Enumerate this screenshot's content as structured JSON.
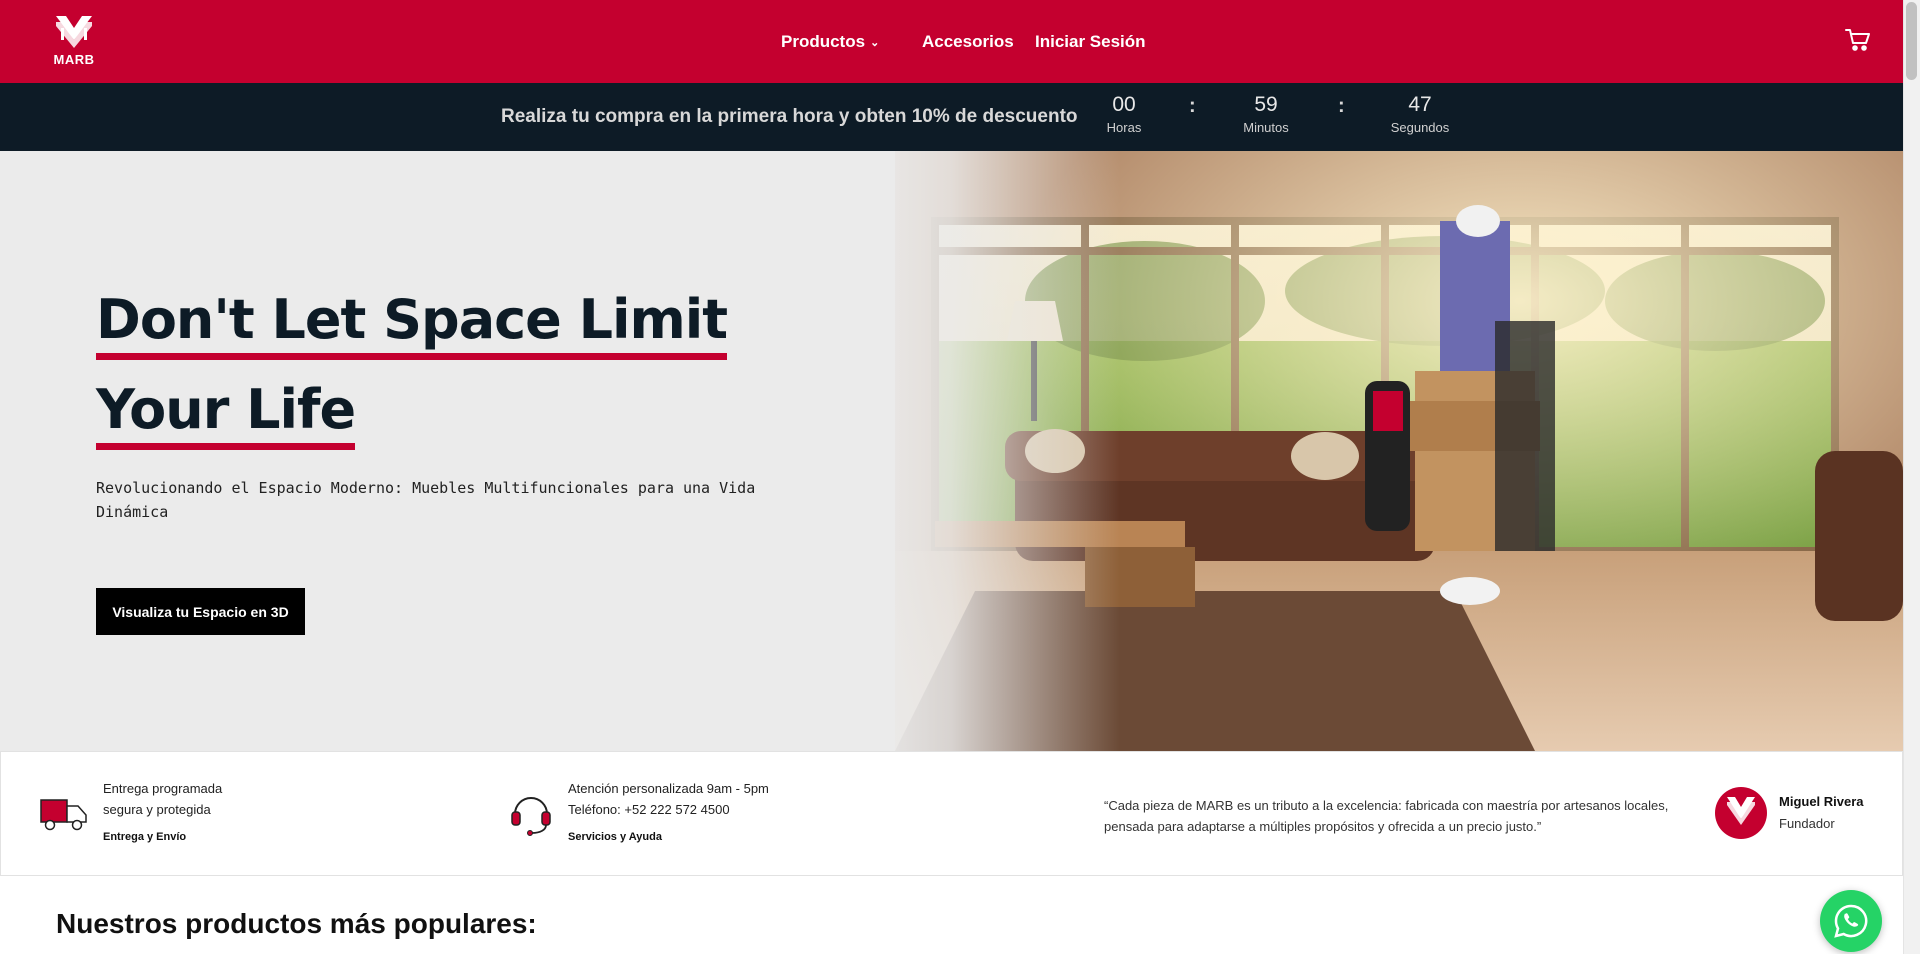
{
  "header": {
    "logo_text": "MARB",
    "nav": {
      "productos": "Productos",
      "accesorios": "Accesorios",
      "login": "Iniciar Sesión"
    },
    "cart_icon": "cart-icon",
    "brand_color": "#c4002f"
  },
  "promo": {
    "text": "Realiza tu compra en la primera hora y obten 10% de descuento",
    "countdown": {
      "hours": "00",
      "hours_label": "Horas",
      "minutes": "59",
      "minutes_label": "Minutos",
      "seconds": "47",
      "seconds_label": "Segundos",
      "separator": ":"
    }
  },
  "hero": {
    "title_line1_a": "Don't Let Sp",
    "title_line1_b": "ace Limit",
    "title_line2": "Your Life",
    "subtitle": "Revolucionando el Espacio Moderno: Muebles Multifuncionales para una Vida Dinámica",
    "button": "Visualiza tu Espacio en 3D"
  },
  "info": {
    "delivery": {
      "line1": "Entrega programada",
      "line2": "segura y protegida",
      "label": "Entrega y Envío",
      "icon": "truck-icon"
    },
    "support": {
      "line1": "Atención personalizada 9am - 5pm",
      "line2": "Teléfono: +52 222 572 4500",
      "label": "Servicios y Ayuda",
      "icon": "headset-icon"
    },
    "quote": "“Cada pieza de MARB es un tributo a la excelencia: fabricada con maestría por artesanos locales, pensada para adaptarse a múltiples propósitos y ofrecida a un precio justo.”",
    "founder": {
      "name": "Miguel Rivera",
      "role": "Fundador"
    }
  },
  "popular": {
    "title": "Nuestros productos más populares:"
  },
  "whatsapp_icon": "whatsapp-icon"
}
